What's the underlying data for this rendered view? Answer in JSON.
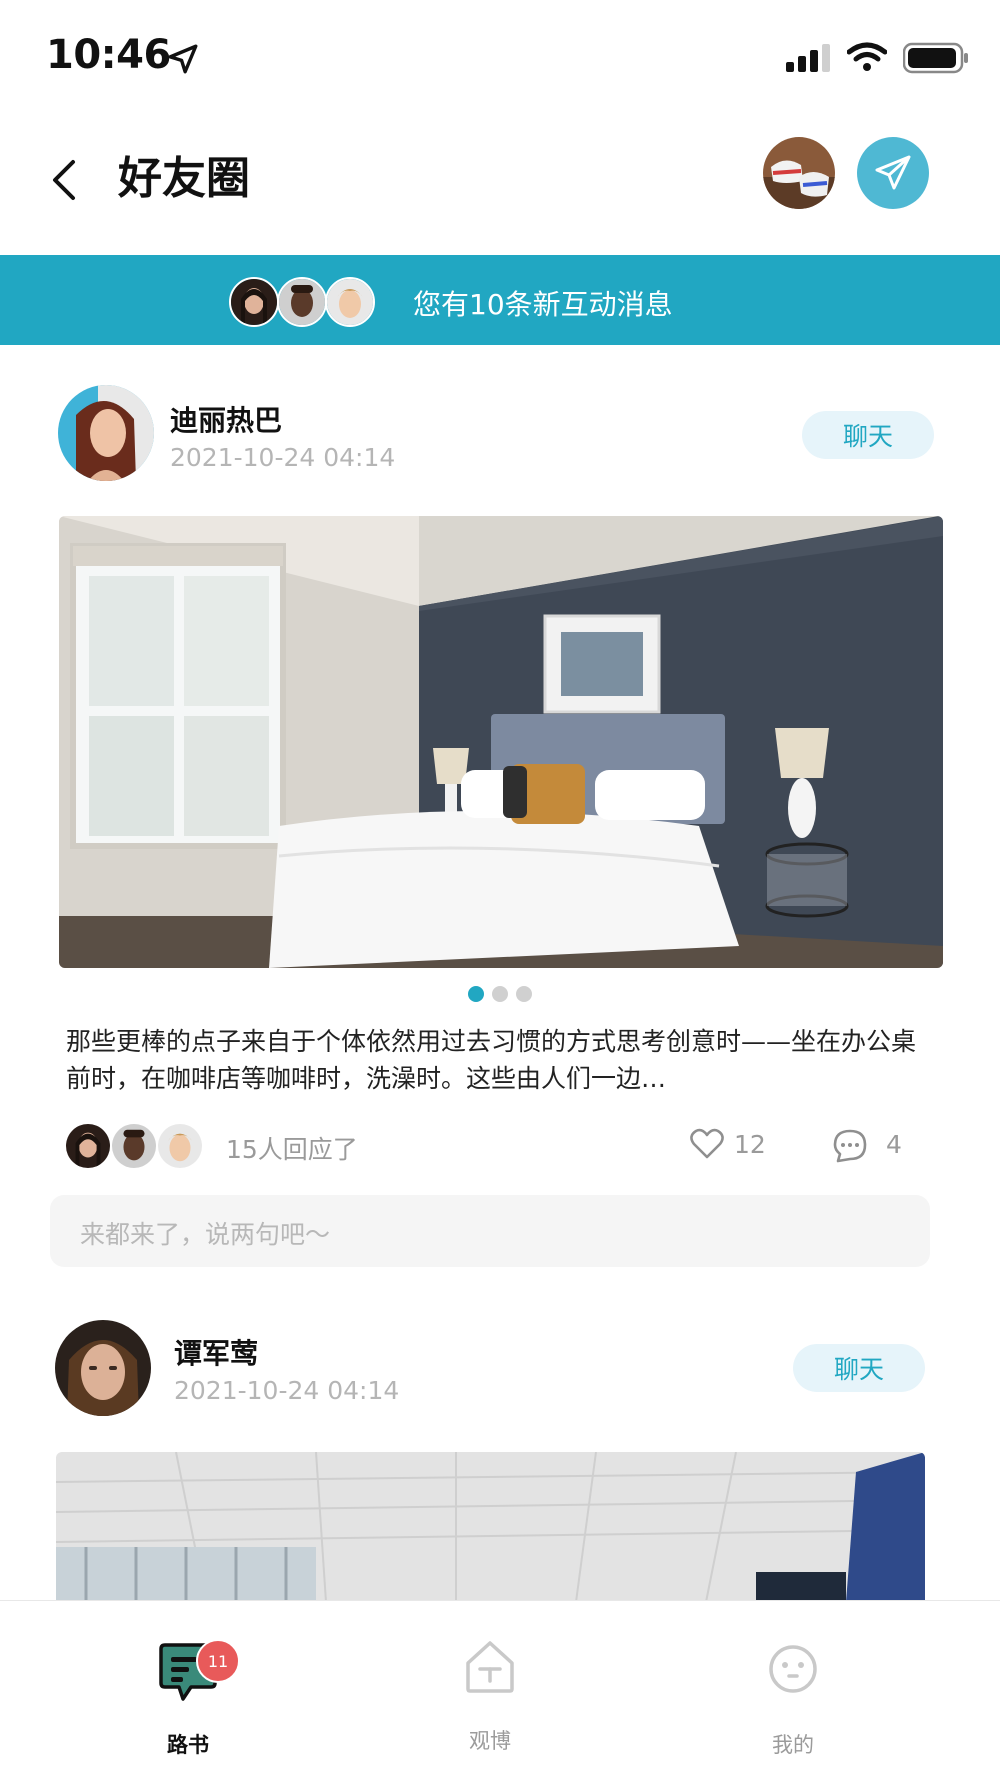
{
  "status_bar": {
    "time": "10:46",
    "icons": [
      "location-arrow-icon",
      "signal-icon",
      "wifi-icon",
      "battery-icon"
    ]
  },
  "header": {
    "title": "好友圈",
    "icons": [
      "back-chevron-icon",
      "user-avatar",
      "send-paper-plane-icon"
    ],
    "accent_color": "#4FB8D3"
  },
  "banner": {
    "text": "您有10条新互动消息",
    "background": "#21A7C2"
  },
  "posts": [
    {
      "author": "迪丽热巴",
      "time": "2021-10-24 04:14",
      "chat_label": "聊天",
      "text": "那些更棒的点子来自于个体依然用过去习惯的方式思考创意时——坐在办公桌前时，在咖啡店等咖啡时，洗澡时。这些由人们一边…",
      "responses": "15人回应了",
      "likes": "12",
      "comments": "4",
      "comment_placeholder": "来都来了，说两句吧～",
      "carousel": {
        "count": 3,
        "active_index": 0
      }
    },
    {
      "author": "谭军莺",
      "time": "2021-10-24 04:14",
      "chat_label": "聊天"
    }
  ],
  "tabbar": {
    "tabs": [
      {
        "label": "路书",
        "icon": "message-list-icon",
        "active": true,
        "badge": "11"
      },
      {
        "label": "观博",
        "icon": "house-icon",
        "active": false
      },
      {
        "label": "我的",
        "icon": "face-icon",
        "active": false
      }
    ],
    "badge_color": "#E85A5A"
  }
}
